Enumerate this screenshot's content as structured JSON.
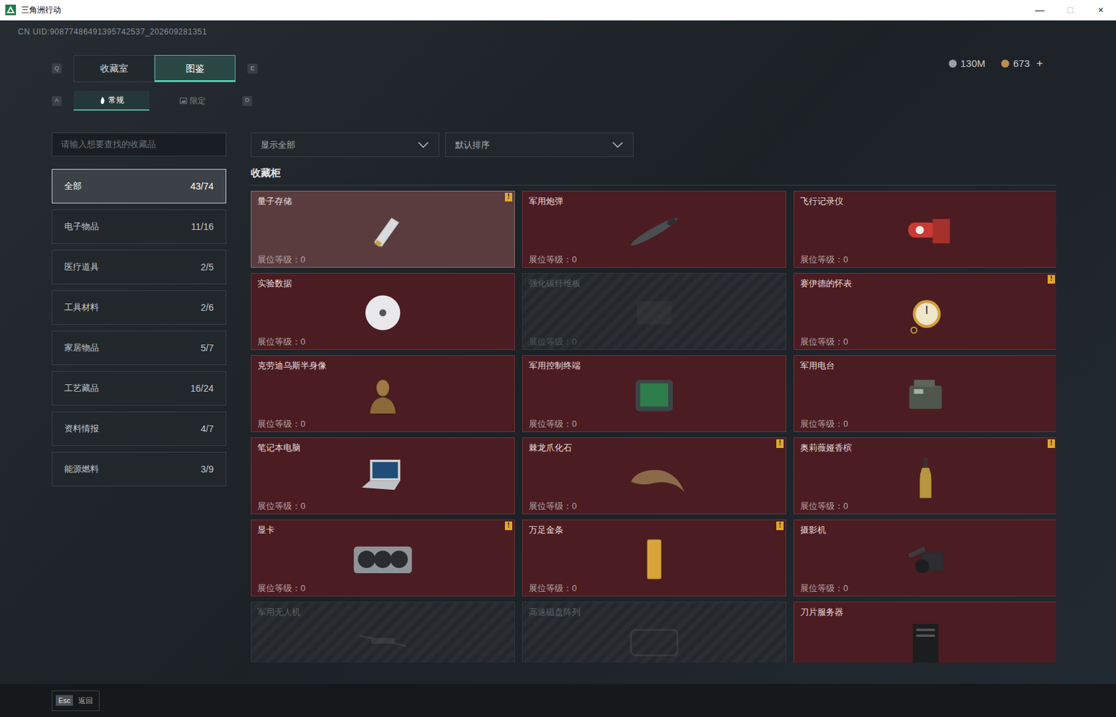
{
  "window": {
    "title": "三角洲行动",
    "controls": [
      "—",
      "□",
      "×"
    ]
  },
  "uid": "CN UID:90877486491395742537_202609281351",
  "currency": [
    {
      "value": "130M",
      "plus": ""
    },
    {
      "value": "673",
      "plus": "+"
    }
  ],
  "tabs": {
    "prev_key": "Q",
    "next_key": "E",
    "items": [
      {
        "label": "收藏室",
        "selected": false
      },
      {
        "label": "图鉴",
        "selected": true
      }
    ]
  },
  "subtabs": {
    "prev_key": "A",
    "next_key": "D",
    "items": [
      {
        "label": "常规",
        "selected": true
      },
      {
        "label": "限定",
        "selected": false
      }
    ]
  },
  "search": {
    "placeholder": "请输入想要查找的收藏品"
  },
  "filters": [
    {
      "label": "显示全部"
    },
    {
      "label": "默认排序"
    }
  ],
  "sidebar": {
    "items": [
      {
        "label": "全部",
        "count": "43/74",
        "selected": true
      },
      {
        "label": "电子物品",
        "count": "11/16",
        "selected": false
      },
      {
        "label": "医疗道具",
        "count": "2/5",
        "selected": false
      },
      {
        "label": "工具材料",
        "count": "2/6",
        "selected": false
      },
      {
        "label": "家居物品",
        "count": "5/7",
        "selected": false
      },
      {
        "label": "工艺藏品",
        "count": "16/24",
        "selected": false
      },
      {
        "label": "资料情报",
        "count": "4/7",
        "selected": false
      },
      {
        "label": "能源燃料",
        "count": "3/9",
        "selected": false
      }
    ]
  },
  "section": {
    "title": "收藏柜"
  },
  "items": [
    {
      "name": "量子存储",
      "level_text": "展位等级：0",
      "owned": true,
      "alert": "!",
      "highlighted": true
    },
    {
      "name": "军用炮弹",
      "level_text": "展位等级：0",
      "owned": true,
      "alert": "",
      "highlighted": false
    },
    {
      "name": "飞行记录仪",
      "level_text": "展位等级：0",
      "owned": true,
      "alert": "",
      "highlighted": false
    },
    {
      "name": "实验数据",
      "level_text": "展位等级：0",
      "owned": true,
      "alert": "",
      "highlighted": false
    },
    {
      "name": "强化碳纤维板",
      "level_text": "展位等级：0",
      "owned": false,
      "alert": "",
      "highlighted": false
    },
    {
      "name": "赛伊德的怀表",
      "level_text": "展位等级：0",
      "owned": true,
      "alert": "!",
      "highlighted": false
    },
    {
      "name": "克劳迪乌斯半身像",
      "level_text": "展位等级：0",
      "owned": true,
      "alert": "",
      "highlighted": false
    },
    {
      "name": "军用控制终端",
      "level_text": "展位等级：0",
      "owned": true,
      "alert": "",
      "highlighted": false
    },
    {
      "name": "军用电台",
      "level_text": "展位等级：0",
      "owned": true,
      "alert": "",
      "highlighted": false
    },
    {
      "name": "笔记本电脑",
      "level_text": "展位等级：0",
      "owned": true,
      "alert": "",
      "highlighted": false
    },
    {
      "name": "棘龙爪化石",
      "level_text": "展位等级：0",
      "owned": true,
      "alert": "!",
      "highlighted": false
    },
    {
      "name": "奥莉薇娅香槟",
      "level_text": "展位等级：0",
      "owned": true,
      "alert": "!",
      "highlighted": false
    },
    {
      "name": "显卡",
      "level_text": "展位等级：0",
      "owned": true,
      "alert": "!",
      "highlighted": false
    },
    {
      "name": "万足金条",
      "level_text": "展位等级：0",
      "owned": true,
      "alert": "!",
      "highlighted": false
    },
    {
      "name": "摄影机",
      "level_text": "展位等级：0",
      "owned": true,
      "alert": "",
      "highlighted": false
    },
    {
      "name": "军用无人机",
      "level_text": "",
      "owned": false,
      "alert": "",
      "highlighted": false
    },
    {
      "name": "高速磁盘阵列",
      "level_text": "",
      "owned": false,
      "alert": "",
      "highlighted": false
    },
    {
      "name": "刀片服务器",
      "level_text": "",
      "owned": true,
      "alert": "",
      "highlighted": false
    }
  ],
  "footer": {
    "key": "Esc",
    "label": "返回"
  }
}
